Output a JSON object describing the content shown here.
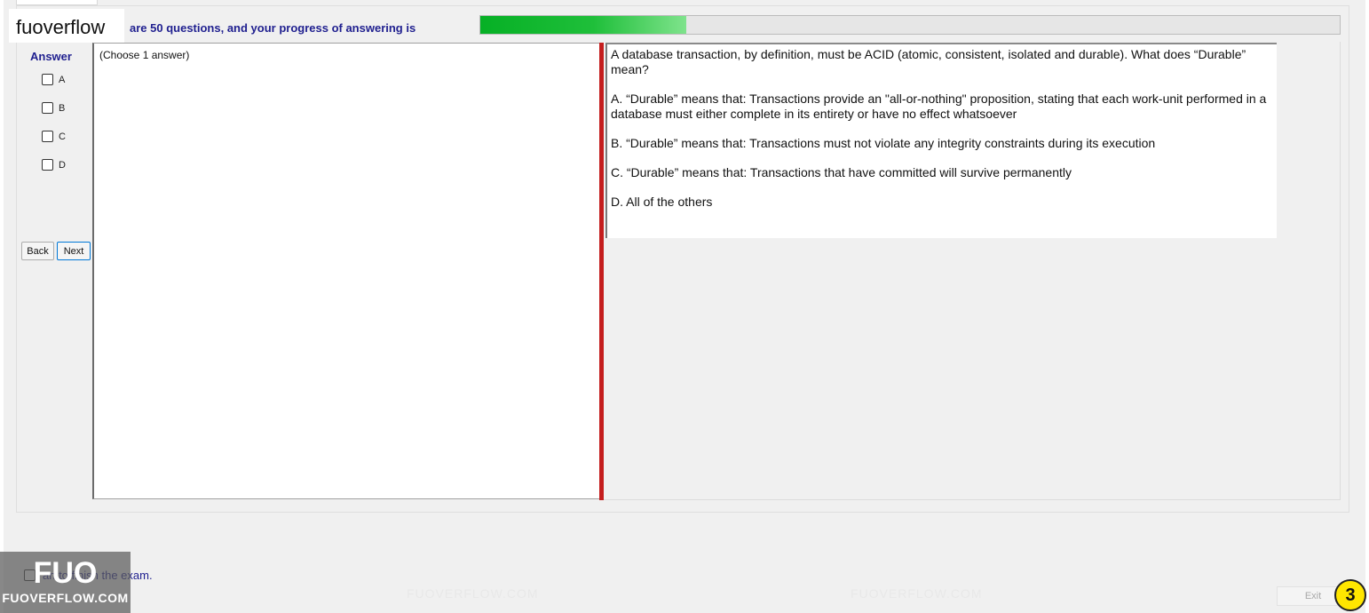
{
  "brand": "fuoverflow",
  "progress": {
    "text": "are 50 questions, and your progress of answering is",
    "fraction": 0.24
  },
  "answer": {
    "label": "Answer",
    "options": [
      "A",
      "B",
      "C",
      "D"
    ]
  },
  "nav": {
    "back": "Back",
    "next": "Next"
  },
  "left_panel": {
    "instruction": "(Choose 1 answer)"
  },
  "question": {
    "stem": "A database transaction, by definition, must be ACID (atomic, consistent, isolated and durable). What does “Durable” mean?",
    "choices": [
      "A.  “Durable” means that: Transactions provide an \"all-or-nothing\" proposition, stating that each work-unit performed in a database must either complete in its entirety or have no effect whatsoever",
      "B.  “Durable” means that: Transactions must not violate any integrity constraints during its execution",
      "C.  “Durable” means that: Transactions that have committed will survive permanently",
      "D.  All of the others"
    ]
  },
  "finish": {
    "text": "an to finish the exam."
  },
  "exit_label": "Exit",
  "badge": "3",
  "logo": {
    "big": "FUO",
    "small": "FUOVERFLOW.COM"
  },
  "watermark": "FUOVERFLOW.COM",
  "colors": {
    "accent_text": "#1f1f8f",
    "progress_green": "#06b025",
    "divider_red": "#c41d1d",
    "badge_yellow": "#ffe600"
  }
}
